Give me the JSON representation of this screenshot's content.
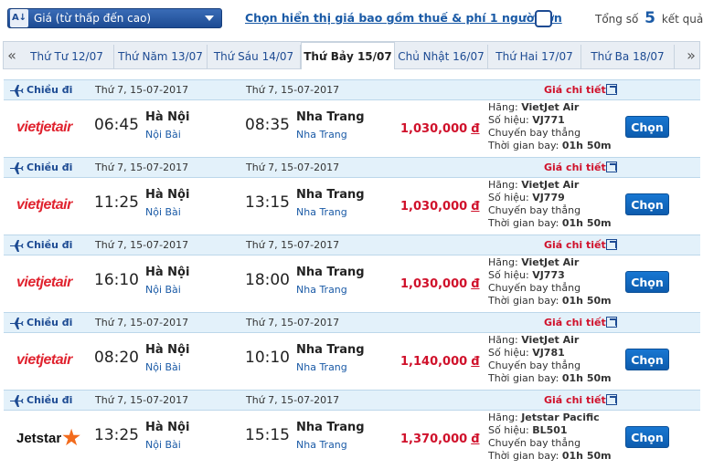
{
  "toolbar": {
    "sort_label": "Giá (từ thấp đến cao)",
    "sort_icon": "A↓",
    "tax_toggle_label": "Chọn hiển thị giá bao gồm thuế & phí 1 người lớn",
    "result_prefix": "Tổng số",
    "result_count": "5",
    "result_suffix": "kết quả"
  },
  "dates": {
    "prev": "«",
    "next": "»",
    "tabs": [
      {
        "label": "Thứ Tư 12/07",
        "active": false
      },
      {
        "label": "Thứ Năm 13/07",
        "active": false
      },
      {
        "label": "Thứ Sáu 14/07",
        "active": false
      },
      {
        "label": "Thứ Bảy 15/07",
        "active": true
      },
      {
        "label": "Chủ Nhật 16/07",
        "active": false
      },
      {
        "label": "Thứ Hai 17/07",
        "active": false
      },
      {
        "label": "Thứ Ba 18/07",
        "active": false
      }
    ]
  },
  "flights": [
    {
      "direction": "Chiều đi",
      "dep_date": "Thứ 7, 15-07-2017",
      "arr_date": "Thứ 7, 15-07-2017",
      "detail_label": "Giá chi tiết",
      "airline_logo": "vietjetair",
      "logo_text": "vietjetair",
      "dep_time": "06:45",
      "dep_city": "Hà Nội",
      "dep_airport": "Nội Bài",
      "arr_time": "08:35",
      "arr_city": "Nha Trang",
      "arr_airport": "Nha Trang",
      "price": "1,030,000",
      "currency": "đ",
      "airline_label": "Hãng:",
      "airline": "VietJet Air",
      "flight_no_label": "Số hiệu:",
      "flight_no": "VJ771",
      "route_type": "Chuyến bay thẳng",
      "duration_label": "Thời gian bay:",
      "duration": "01h 50m",
      "select_label": "Chọn"
    },
    {
      "direction": "Chiều đi",
      "dep_date": "Thứ 7, 15-07-2017",
      "arr_date": "Thứ 7, 15-07-2017",
      "detail_label": "Giá chi tiết",
      "airline_logo": "vietjetair",
      "logo_text": "vietjetair",
      "dep_time": "11:25",
      "dep_city": "Hà Nội",
      "dep_airport": "Nội Bài",
      "arr_time": "13:15",
      "arr_city": "Nha Trang",
      "arr_airport": "Nha Trang",
      "price": "1,030,000",
      "currency": "đ",
      "airline_label": "Hãng:",
      "airline": "VietJet Air",
      "flight_no_label": "Số hiệu:",
      "flight_no": "VJ779",
      "route_type": "Chuyến bay thẳng",
      "duration_label": "Thời gian bay:",
      "duration": "01h 50m",
      "select_label": "Chọn"
    },
    {
      "direction": "Chiều đi",
      "dep_date": "Thứ 7, 15-07-2017",
      "arr_date": "Thứ 7, 15-07-2017",
      "detail_label": "Giá chi tiết",
      "airline_logo": "vietjetair",
      "logo_text": "vietjetair",
      "dep_time": "16:10",
      "dep_city": "Hà Nội",
      "dep_airport": "Nội Bài",
      "arr_time": "18:00",
      "arr_city": "Nha Trang",
      "arr_airport": "Nha Trang",
      "price": "1,030,000",
      "currency": "đ",
      "airline_label": "Hãng:",
      "airline": "VietJet Air",
      "flight_no_label": "Số hiệu:",
      "flight_no": "VJ773",
      "route_type": "Chuyến bay thẳng",
      "duration_label": "Thời gian bay:",
      "duration": "01h 50m",
      "select_label": "Chọn"
    },
    {
      "direction": "Chiều đi",
      "dep_date": "Thứ 7, 15-07-2017",
      "arr_date": "Thứ 7, 15-07-2017",
      "detail_label": "Giá chi tiết",
      "airline_logo": "vietjetair",
      "logo_text": "vietjetair",
      "dep_time": "08:20",
      "dep_city": "Hà Nội",
      "dep_airport": "Nội Bài",
      "arr_time": "10:10",
      "arr_city": "Nha Trang",
      "arr_airport": "Nha Trang",
      "price": "1,140,000",
      "currency": "đ",
      "airline_label": "Hãng:",
      "airline": "VietJet Air",
      "flight_no_label": "Số hiệu:",
      "flight_no": "VJ781",
      "route_type": "Chuyến bay thẳng",
      "duration_label": "Thời gian bay:",
      "duration": "01h 50m",
      "select_label": "Chọn"
    },
    {
      "direction": "Chiều đi",
      "dep_date": "Thứ 7, 15-07-2017",
      "arr_date": "Thứ 7, 15-07-2017",
      "detail_label": "Giá chi tiết",
      "airline_logo": "jetstar",
      "logo_text": "Jetstar",
      "dep_time": "13:25",
      "dep_city": "Hà Nội",
      "dep_airport": "Nội Bài",
      "arr_time": "15:15",
      "arr_city": "Nha Trang",
      "arr_airport": "Nha Trang",
      "price": "1,370,000",
      "currency": "đ",
      "airline_label": "Hãng:",
      "airline": "Jetstar Pacific",
      "flight_no_label": "Số hiệu:",
      "flight_no": "BL501",
      "route_type": "Chuyến bay thẳng",
      "duration_label": "Thời gian bay:",
      "duration": "01h 50m",
      "select_label": "Chọn"
    }
  ],
  "colors": {
    "brand_blue": "#1d4b93",
    "price_red": "#d0112b",
    "row_header_bg": "#e3f1fa",
    "button_blue": "#1877d2"
  }
}
